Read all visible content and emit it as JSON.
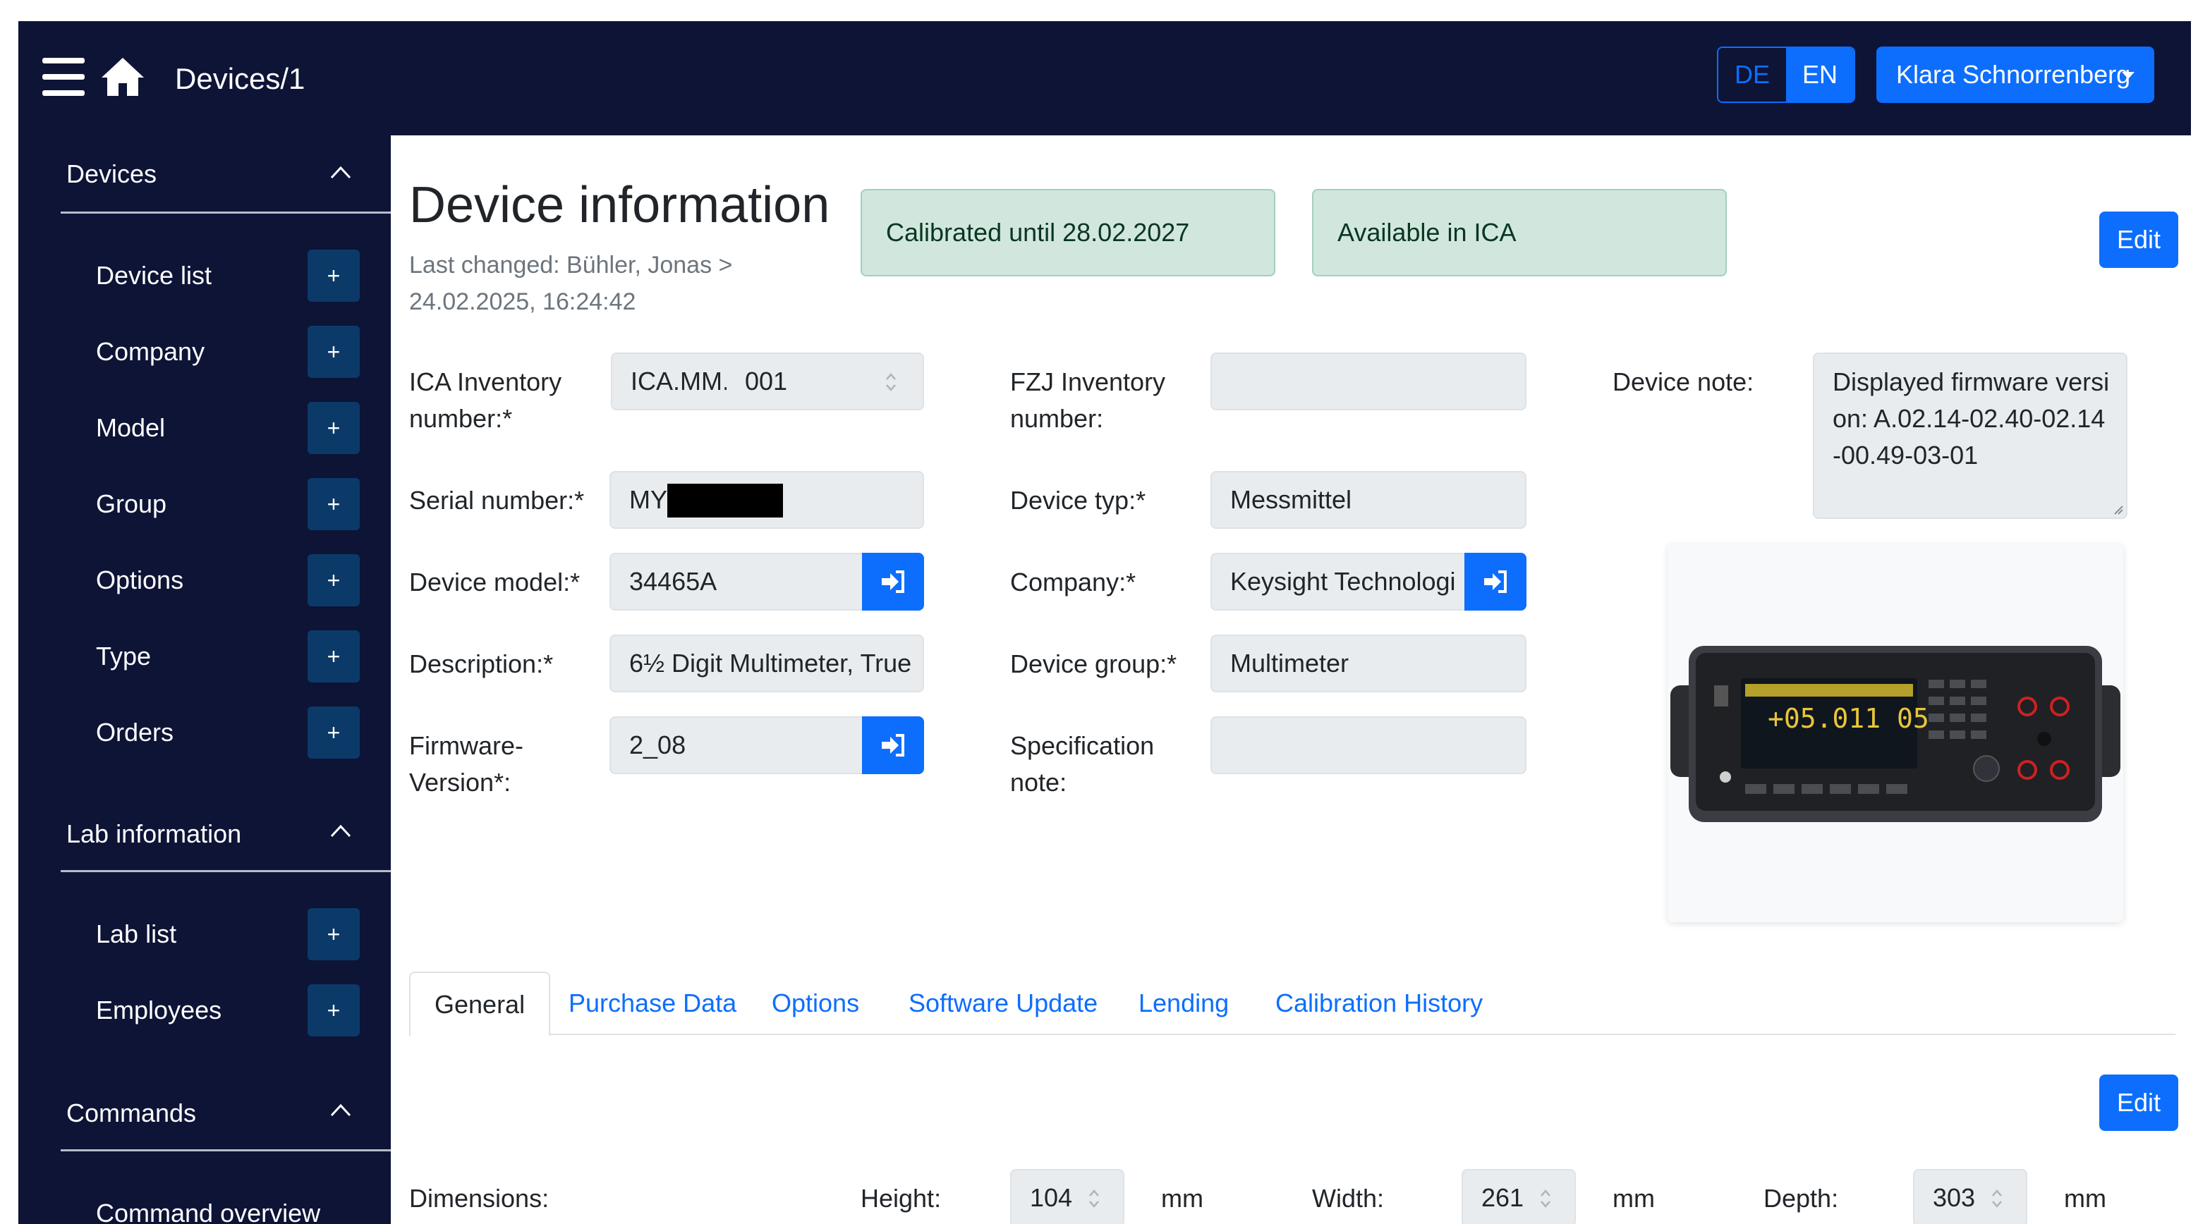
{
  "navbar": {
    "breadcrumb": "Devices/1",
    "lang_de": "DE",
    "lang_en": "EN",
    "user_name": "Klara Schnorrenberg"
  },
  "sidebar": {
    "sections": [
      {
        "title": "Devices",
        "items": [
          {
            "label": "Device list",
            "action": "+"
          },
          {
            "label": "Company",
            "action": "+"
          },
          {
            "label": "Model",
            "action": "+"
          },
          {
            "label": "Group",
            "action": "+"
          },
          {
            "label": "Options",
            "action": "+"
          },
          {
            "label": "Type",
            "action": "+"
          },
          {
            "label": "Orders",
            "action": "+"
          }
        ]
      },
      {
        "title": "Lab information",
        "items": [
          {
            "label": "Lab list",
            "action": "+"
          },
          {
            "label": "Employees",
            "action": "+"
          }
        ]
      },
      {
        "title": "Commands",
        "items": [
          {
            "label": "Command overview"
          }
        ]
      }
    ]
  },
  "device": {
    "title": "Device information",
    "last_changed": "Last changed: Bühler, Jonas > 24.02.2025, 16:24:42",
    "status_calibrated": "Calibrated until 28.02.2027",
    "status_available": "Available in ICA",
    "edit_label": "Edit",
    "fields": {
      "ica_inventory_label": "ICA Inventory number:*",
      "ica_prefix": "ICA.MM.",
      "ica_number": "001",
      "fzj_inventory_label": "FZJ Inventory number:",
      "fzj_inventory_value": "",
      "device_note_label": "Device note:",
      "device_note_value": "Displayed firmware version: A.02.14-02.40-02.14-00.49-03-01",
      "serial_label": "Serial number:*",
      "serial_value": "MY",
      "device_typ_label": "Device typ:*",
      "device_typ_value": "Messmittel",
      "model_label": "Device model:*",
      "model_value": "34465A",
      "company_label": "Company:*",
      "company_value": "Keysight Technologi",
      "description_label": "Description:*",
      "description_value": "6½ Digit Multimeter, True",
      "group_label": "Device group:*",
      "group_value": "Multimeter",
      "firmware_label": "Firmware-Version*:",
      "firmware_value": "2_08",
      "spec_note_label": "Specification note:",
      "spec_note_value": ""
    }
  },
  "tabs": [
    {
      "label": "General",
      "active": true
    },
    {
      "label": "Purchase Data"
    },
    {
      "label": "Options"
    },
    {
      "label": "Software Update"
    },
    {
      "label": "Lending"
    },
    {
      "label": "Calibration History"
    }
  ],
  "general": {
    "edit_label": "Edit",
    "dimensions_label": "Dimensions:",
    "height_label": "Height:",
    "height_value": "104",
    "width_label": "Width:",
    "width_value": "261",
    "depth_label": "Depth:",
    "depth_value": "303",
    "unit": "mm"
  },
  "colors": {
    "navbar_bg": "#0d1436",
    "primary": "#0d6efd",
    "sidebar_plus_bg": "#0b3a69",
    "success_bg": "#d1e7dd"
  }
}
